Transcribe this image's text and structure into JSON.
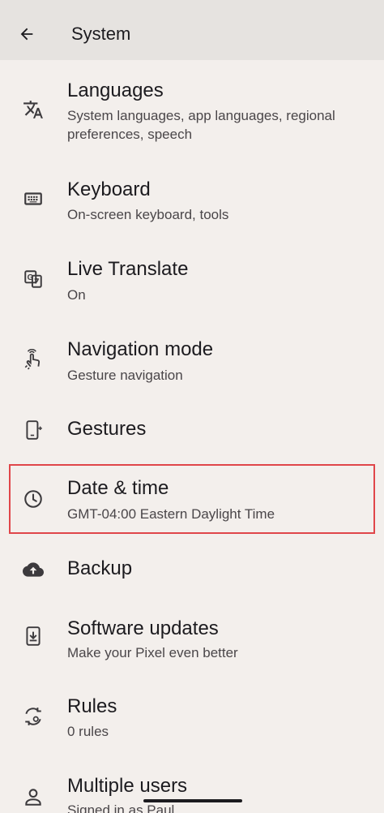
{
  "header": {
    "title": "System",
    "back_icon": "arrow-back-icon"
  },
  "items": [
    {
      "label": "Languages",
      "sub": "System languages, app languages, regional preferences, speech",
      "icon": "translate-icon"
    },
    {
      "label": "Keyboard",
      "sub": "On-screen keyboard, tools",
      "icon": "keyboard-icon"
    },
    {
      "label": "Live Translate",
      "sub": "On",
      "icon": "live-translate-icon"
    },
    {
      "label": "Navigation mode",
      "sub": "Gesture navigation",
      "icon": "gesture-hand-icon"
    },
    {
      "label": "Gestures",
      "sub": "",
      "icon": "phone-gestures-icon"
    },
    {
      "label": "Date & time",
      "sub": "GMT-04:00 Eastern Daylight Time",
      "icon": "clock-icon"
    },
    {
      "label": "Backup",
      "sub": "",
      "icon": "cloud-upload-icon"
    },
    {
      "label": "Software updates",
      "sub": "Make your Pixel even better",
      "icon": "system-update-icon"
    },
    {
      "label": "Rules",
      "sub": "0 rules",
      "icon": "rules-icon"
    },
    {
      "label": "Multiple users",
      "sub": "Signed in as Paul",
      "icon": "person-icon"
    }
  ],
  "colors": {
    "background": "#f3efec",
    "header": "#e6e3e0",
    "highlight": "#e0464a"
  }
}
